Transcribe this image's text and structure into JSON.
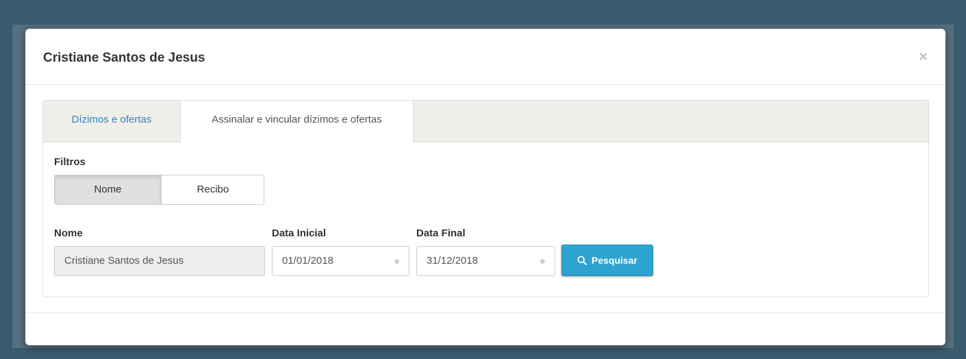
{
  "modal": {
    "title": "Cristiane Santos de Jesus",
    "close_label": "×"
  },
  "tabs": [
    {
      "label": "Dízimos e ofertas",
      "active": false
    },
    {
      "label": "Assinalar e vincular dízimos e ofertas",
      "active": true
    }
  ],
  "filters": {
    "label": "Filtros",
    "options": [
      {
        "label": "Nome",
        "selected": true
      },
      {
        "label": "Recibo",
        "selected": false
      }
    ]
  },
  "form": {
    "nome": {
      "label": "Nome",
      "value": "Cristiane Santos de Jesus"
    },
    "data_inicial": {
      "label": "Data Inicial",
      "value": "01/01/2018"
    },
    "data_final": {
      "label": "Data Final",
      "value": "31/12/2018"
    },
    "search_button": {
      "label": "Pesquisar",
      "icon": "search-icon"
    }
  },
  "colors": {
    "accent": "#2fa3cf",
    "link": "#3a7fc4",
    "backdrop": "#3b5b70"
  }
}
